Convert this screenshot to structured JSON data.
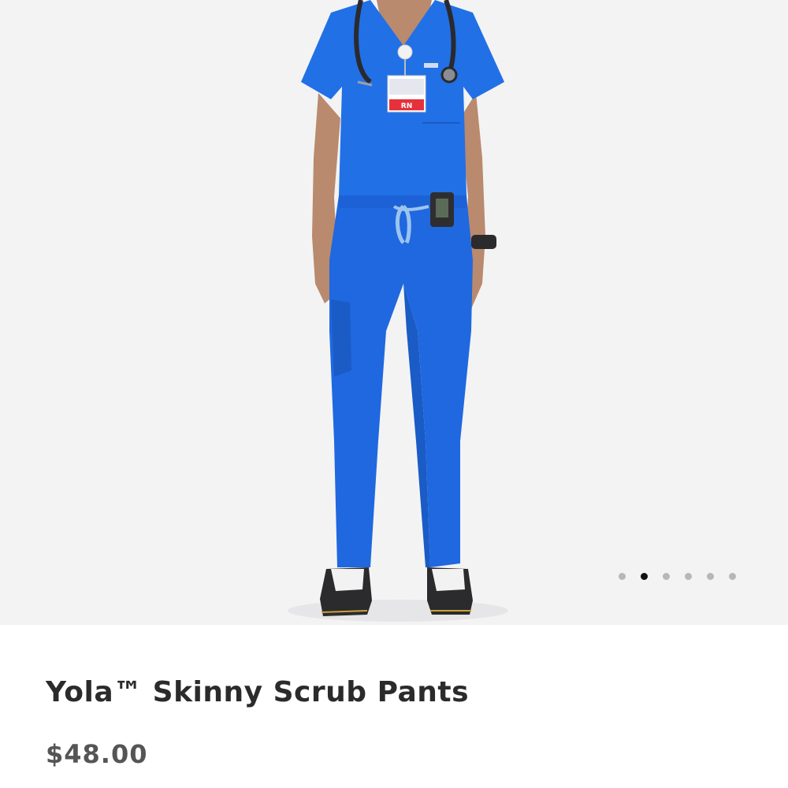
{
  "product": {
    "title": "Yola™ Skinny Scrub Pants",
    "price": "$48.00"
  },
  "gallery": {
    "image_description": "model wearing royal blue scrub top and pants with stethoscope, badge and pager",
    "total_images": 6,
    "active_index": 1,
    "dot_icons": [
      "dot-icon",
      "dot-icon",
      "dot-icon",
      "dot-icon",
      "dot-icon",
      "dot-icon"
    ]
  },
  "colors": {
    "scrub_blue": "#1f68e0",
    "photo_background": "#f3f3f4",
    "title_text": "#2b2b2b",
    "price_text": "#555555",
    "dot_active": "#111111",
    "dot_inactive": "#b7b7b9"
  }
}
